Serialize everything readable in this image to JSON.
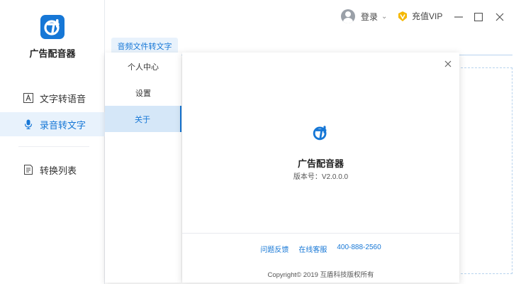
{
  "app": {
    "name": "广告配音器"
  },
  "sidebar": {
    "items": [
      {
        "label": "文字转语音",
        "icon": "text-a-icon"
      },
      {
        "label": "录音转文字",
        "icon": "microphone-icon",
        "active": true
      },
      {
        "label": "转换列表",
        "icon": "list-doc-icon"
      }
    ]
  },
  "titlebar": {
    "login_label": "登录",
    "vip_label": "充值VIP",
    "controls": [
      "minimize",
      "maximize",
      "close"
    ]
  },
  "main": {
    "tab_label": "音频文件转文字"
  },
  "menu": {
    "items": [
      {
        "label": "个人中心"
      },
      {
        "label": "设置"
      },
      {
        "label": "关于",
        "selected": true
      }
    ]
  },
  "about": {
    "app_name": "广告配音器",
    "version": "版本号：V2.0.0.0",
    "links": {
      "feedback": "问题反馈",
      "online_service": "在线客服",
      "phone": "400-888-2560"
    },
    "copyright": "Copyright© 2019 互盾科技版权所有"
  },
  "colors": {
    "accent": "#1677d6",
    "active_bg": "#e8f2fc",
    "vip_gold": "#f5b800"
  }
}
